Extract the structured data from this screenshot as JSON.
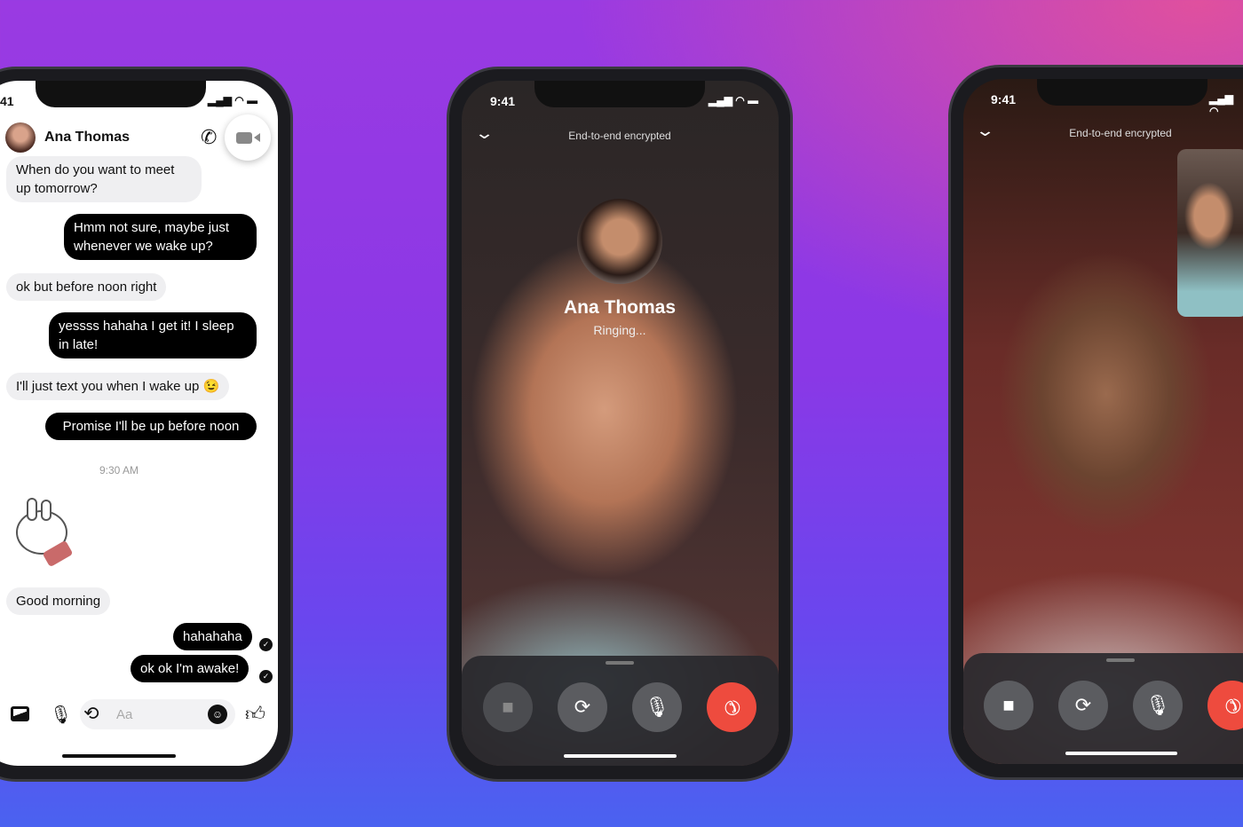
{
  "chat_phone": {
    "time": "41",
    "contact_name": "Ana Thomas",
    "messages": [
      {
        "side": "received",
        "text": "When do you want to meet up tomorrow?"
      },
      {
        "side": "sent",
        "text": "Hmm not sure, maybe just whenever we wake up?"
      },
      {
        "side": "received",
        "text": "ok but before noon right"
      },
      {
        "side": "sent",
        "text": "yessss hahaha I get it! I sleep in late!"
      },
      {
        "side": "received",
        "text": "I'll just text you when I wake up 😉"
      },
      {
        "side": "sent",
        "text": "Promise I'll be up before noon"
      },
      {
        "side": "received",
        "text": "Good morning"
      },
      {
        "side": "sent",
        "text": "hahahaha"
      },
      {
        "side": "sent",
        "text": "ok ok I'm awake!"
      }
    ],
    "timestamp": "9:30 AM",
    "composer_placeholder": "Aa",
    "icons": [
      "phone-icon",
      "video-camera-icon",
      "image-icon",
      "microphone-icon",
      "history-icon",
      "emoji-icon",
      "thumbs-up-icon"
    ]
  },
  "ringing_phone": {
    "time": "9:41",
    "encryption_label": "End-to-end encrypted",
    "caller_name": "Ana Thomas",
    "call_status": "Ringing...",
    "controls": [
      "video-off",
      "flip-camera",
      "microphone",
      "end-call"
    ]
  },
  "video_phone": {
    "time": "9:41",
    "encryption_label": "End-to-end encrypted",
    "controls": [
      "video",
      "flip-camera",
      "microphone",
      "end-call"
    ]
  },
  "colors": {
    "end_call": "#ee4b3e",
    "sent_bubble": "#000000",
    "received_bubble": "#efeff1",
    "control_button": "#5b5c60"
  }
}
